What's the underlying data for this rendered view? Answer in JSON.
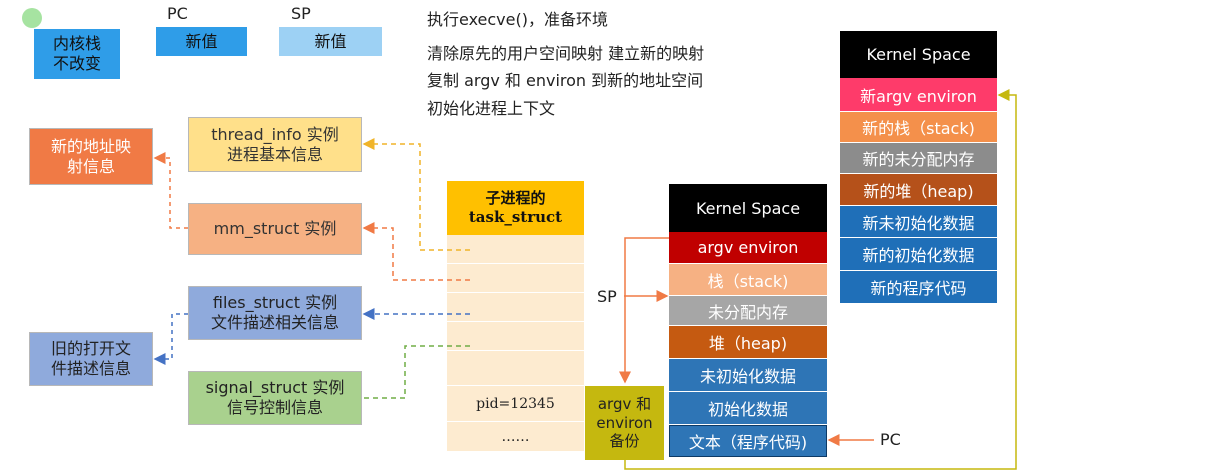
{
  "legend": {
    "kernel_stack": "内核栈\n不改变",
    "pc_label": "PC",
    "pc_value": "新值",
    "sp_label": "SP",
    "sp_value": "新值"
  },
  "info": {
    "line1": "执行execve()，准备环境",
    "line2": "清除原先的用户空间映射 建立新的映射",
    "line3": "复制 argv 和 environ 到新的地址空间",
    "line4": "初始化进程上下文"
  },
  "left": {
    "new_addr_map": "新的地址映\n射信息",
    "thread_info": "thread_info 实例\n进程基本信息",
    "mm_struct": "mm_struct 实例",
    "files_struct": "files_struct 实例\n文件描述相关信息",
    "old_files": "旧的打开文\n件描述信息",
    "signal_struct": "signal_struct 实例\n信号控制信息"
  },
  "task": {
    "header": "子进程的\ntask_struct",
    "pid": "pid=12345",
    "dots": "……"
  },
  "old_mem": {
    "title": "Kernel Space",
    "cells": [
      "argv environ",
      "栈（stack)",
      "未分配内存",
      "堆（heap)",
      "未初始化数据",
      "初始化数据",
      "文本（程序代码)"
    ]
  },
  "new_mem": {
    "title": "Kernel Space",
    "cells": [
      "新argv environ",
      "新的栈（stack)",
      "新的未分配内存",
      "新的堆（heap)",
      "新未初始化数据",
      "新的初始化数据",
      "新的程序代码"
    ]
  },
  "backup": "argv 和\nenviron\n备份",
  "sp_arrow_label": "SP",
  "pc_arrow_label": "PC",
  "colors": {
    "orange_dark": "#f07a45",
    "yellow_light": "#ffe08a",
    "orange_light": "#f6b183",
    "blue_mid": "#8faadc",
    "green_light": "#a9d18e",
    "blue_bright": "#2f9de8",
    "blue_pale": "#9dd1f4",
    "task_header": "#ffc000",
    "task_body": "#fdebd0"
  }
}
